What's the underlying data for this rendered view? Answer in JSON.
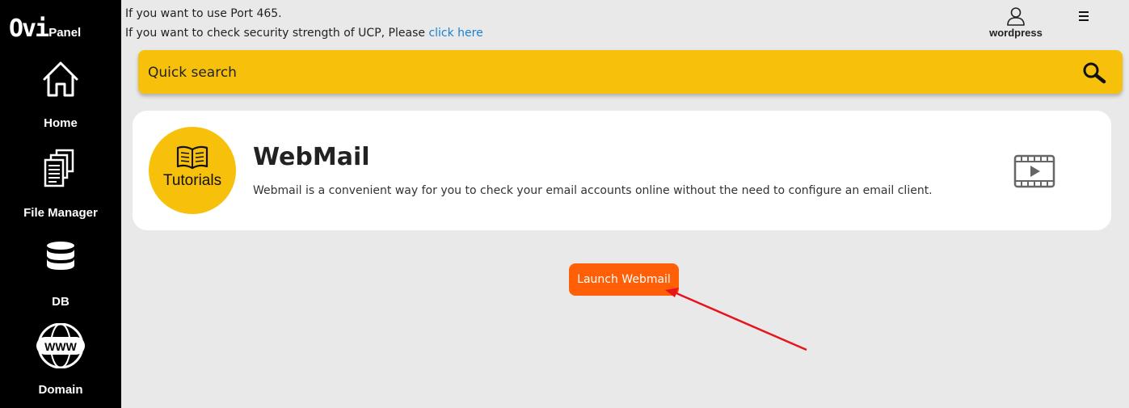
{
  "brand": {
    "logo_main": "Ovi",
    "logo_sub": "Panel"
  },
  "sidebar": {
    "items": [
      {
        "label": "Home",
        "icon": "home-icon"
      },
      {
        "label": "File Manager",
        "icon": "file-manager-icon"
      },
      {
        "label": "DB",
        "icon": "database-icon"
      },
      {
        "label": "Domain",
        "icon": "www-icon"
      }
    ]
  },
  "notices": {
    "line1": "If you want to use Port 465.",
    "line2_text": "If you want to check security strength of UCP, Please ",
    "line2_link": "click here"
  },
  "user": {
    "name": "wordpress",
    "icon": "user-icon"
  },
  "menu": {
    "icon": "hamburger-icon"
  },
  "search": {
    "placeholder": "Quick search",
    "value": "",
    "icon": "search-icon"
  },
  "card": {
    "tutorials_label": "Tutorials",
    "title": "WebMail",
    "description": "Webmail is a convenient way for you to check your email accounts online without the need to configure an email client.",
    "video_icon": "video-icon"
  },
  "launch_button": {
    "label": "Launch Webmail"
  },
  "colors": {
    "sidebar_bg": "#000000",
    "accent_yellow": "#f7c10b",
    "launch_orange": "#ff5f06",
    "link_blue": "#1a7fd1",
    "annotation_arrow": "#e8141b",
    "page_bg": "#e9e9e9"
  }
}
